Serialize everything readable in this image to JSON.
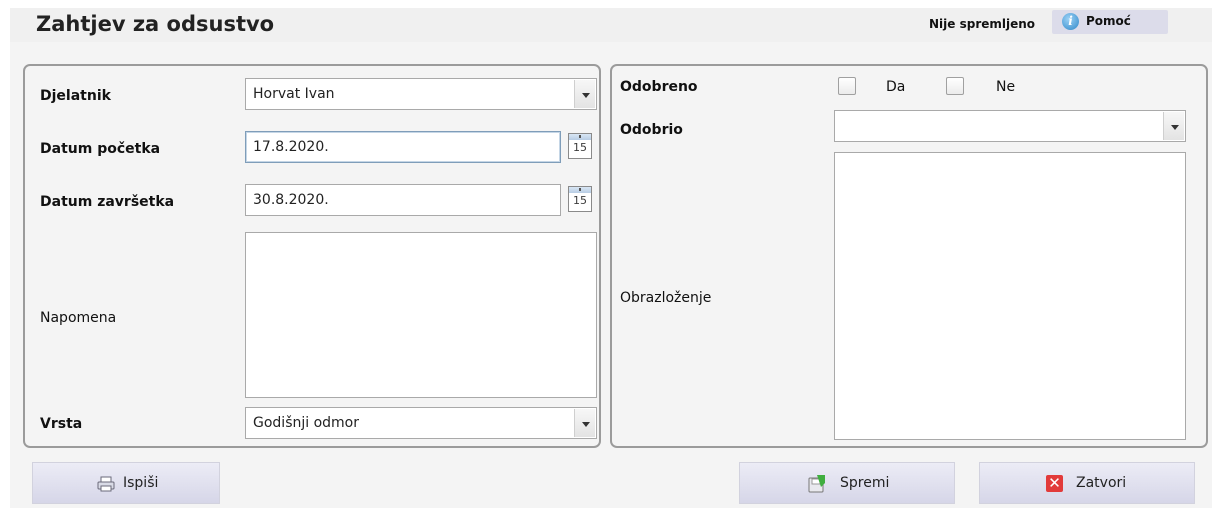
{
  "header": {
    "title": "Zahtjev za odsustvo",
    "status": "Nije spremljeno",
    "help_label": "Pomoć",
    "help_icon": "info-icon"
  },
  "left": {
    "employee_label": "Djelatnik",
    "employee_value": "Horvat Ivan",
    "start_label": "Datum početka",
    "start_value": "17.8.2020.",
    "end_label": "Datum završetka",
    "end_value": "30.8.2020.",
    "calendar_text": "15",
    "note_label": "Napomena",
    "note_value": "",
    "type_label": "Vrsta",
    "type_value": "Godišnji odmor"
  },
  "right": {
    "approved_label": "Odobreno",
    "yes_label": "Da",
    "no_label": "Ne",
    "approved_by_label": "Odobrio",
    "approved_by_value": "",
    "reason_label": "Obrazloženje",
    "reason_value": ""
  },
  "buttons": {
    "print_label": "Ispiši",
    "save_label": "Spremi",
    "close_label": "Zatvori"
  },
  "colors": {
    "button_gradient_top": "#ececf6",
    "button_gradient_bottom": "#d6d6e8",
    "close_icon": "#e23a3a"
  }
}
